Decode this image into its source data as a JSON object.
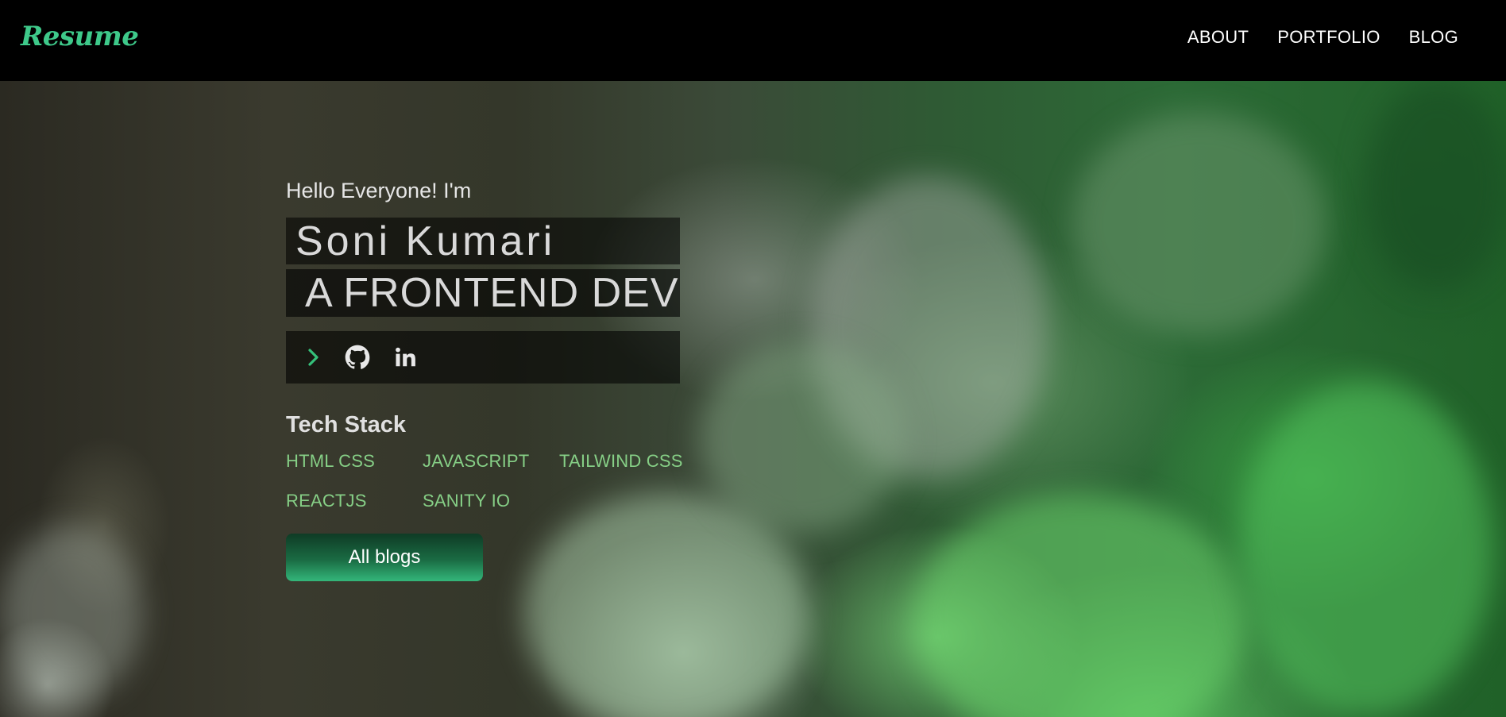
{
  "navbar": {
    "brand": "Resume",
    "links": [
      {
        "label": "ABOUT"
      },
      {
        "label": "PORTFOLIO"
      },
      {
        "label": "BLOG"
      }
    ]
  },
  "hero": {
    "greeting": "Hello Everyone! I'm",
    "name": "Soni Kumari",
    "role": "A FRONTEND DEV",
    "social": {
      "icons": [
        "chevron-right-icon",
        "github-icon",
        "linkedin-icon"
      ]
    },
    "tech_stack": {
      "title": "Tech Stack",
      "items": [
        "HTML CSS",
        "JAVASCRIPT",
        "TAILWIND CSS",
        "REACTJS",
        "SANITY IO"
      ]
    },
    "cta_label": "All blogs"
  },
  "colors": {
    "brand": "#3ec98a",
    "nav_bg": "#000000",
    "tech_item": "#86cf86",
    "cta_top": "#0f3b25",
    "cta_bottom": "#33b67a"
  }
}
